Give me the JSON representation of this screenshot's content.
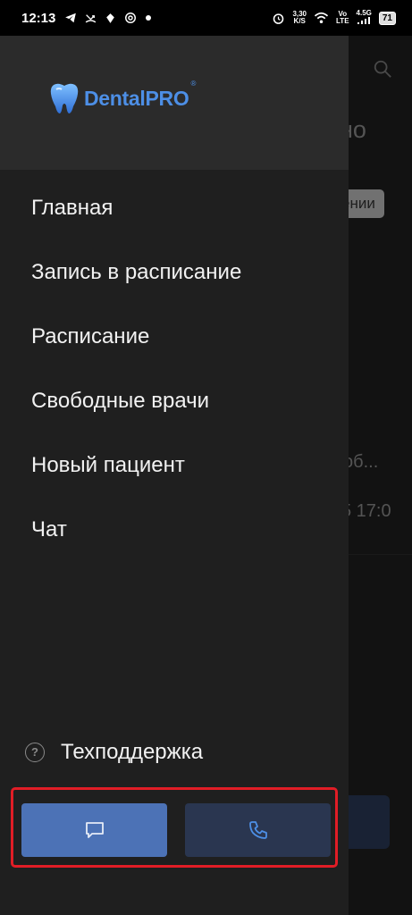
{
  "status_bar": {
    "time": "12:13",
    "left_icons": [
      "telegram-icon",
      "missed-call-icon",
      "app-icon",
      "at-icon",
      "dot-icon"
    ],
    "net_speed_value": "3,30",
    "net_speed_unit": "K/S",
    "volte_top": "Vo",
    "volte_bottom": "LTE",
    "signal_label": "4.5G",
    "battery": "71"
  },
  "background_app": {
    "title_fragment": "но",
    "chip_fragment": "ении",
    "item_fragment": "об...",
    "time_fragment": "5 17:0"
  },
  "drawer": {
    "logo": {
      "brand_left": "Dental",
      "brand_right": "PRO",
      "reg": "®"
    },
    "menu_items": [
      {
        "label": "Главная"
      },
      {
        "label": "Запись в расписание"
      },
      {
        "label": "Расписание"
      },
      {
        "label": "Свободные врачи"
      },
      {
        "label": "Новый пациент"
      },
      {
        "label": "Чат"
      }
    ],
    "support_label": "Техподдержка",
    "support_icon_glyph": "?",
    "buttons": {
      "chat_icon": "chat-bubble-icon",
      "call_icon": "phone-icon"
    }
  },
  "colors": {
    "accent": "#4c72b6",
    "brand": "#4d8fe6",
    "highlight": "#e11d26"
  }
}
